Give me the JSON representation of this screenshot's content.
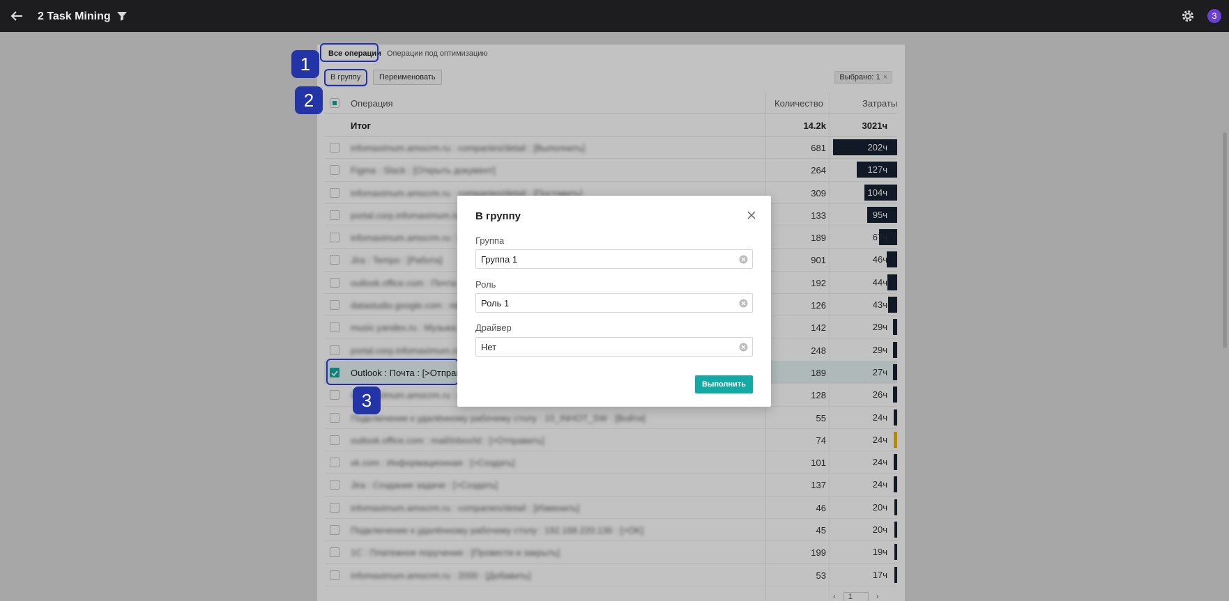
{
  "header": {
    "title": "2 Task Mining",
    "avatar_letter": "З"
  },
  "tabs": {
    "all": "Все операции",
    "optimization": "Операции под оптимизацию"
  },
  "toolbar": {
    "group_btn": "В группу",
    "rename_btn": "Переименовать",
    "selected": "Выбрано: 1",
    "clear": "×"
  },
  "table": {
    "col_operation": "Операция",
    "col_quantity": "Количество",
    "col_cost": "Затраты",
    "total": {
      "label": "Итог",
      "quantity": "14.2k",
      "cost": "3021ч"
    },
    "rows": [
      {
        "name": "infomaximum.amocrm.ru : companies/detail : [Выполнить]",
        "quantity": "681",
        "cost": "202ч",
        "fraction": 1.0
      },
      {
        "name": "Figma : Slack : [Открыть документ]",
        "quantity": "264",
        "cost": "127ч",
        "fraction": 0.63
      },
      {
        "name": "infomaximum.amocrm.ru : companies/detail : [Поставить]",
        "quantity": "309",
        "cost": "104ч",
        "fraction": 0.51
      },
      {
        "name": "portal.corp.infomaximum.ru : Задачи",
        "quantity": "133",
        "cost": "95ч",
        "fraction": 0.47
      },
      {
        "name": "infomaximum.amocrm.ru : leads",
        "quantity": "189",
        "cost": "67ч",
        "fraction": 0.28
      },
      {
        "name": "Jira : Tempo : [Работа]",
        "quantity": "901",
        "cost": "46ч",
        "fraction": 0.16
      },
      {
        "name": "outlook.office.com : Почта",
        "quantity": "192",
        "cost": "44ч",
        "fraction": 0.15
      },
      {
        "name": "datastudio.google.com : reporting",
        "quantity": "126",
        "cost": "43ч",
        "fraction": 0.14
      },
      {
        "name": "music.yandex.ru : Музыка",
        "quantity": "142",
        "cost": "29ч",
        "fraction": 0.07
      },
      {
        "name": "portal.corp.infomaximum.ru : Лента",
        "quantity": "248",
        "cost": "29ч",
        "fraction": 0.07
      },
      {
        "name": "Outlook : Почта : [>Отправить]",
        "quantity": "189",
        "cost": "27ч",
        "fraction": 0.06,
        "selected": true
      },
      {
        "name": "infomaximum.amocrm.ru : contacts",
        "quantity": "128",
        "cost": "26ч",
        "fraction": 0.06
      },
      {
        "name": "Подключение к удалённому рабочему столу : 10_INHOT_SW : [Войти]",
        "quantity": "55",
        "cost": "24ч",
        "fraction": 0.05
      },
      {
        "name": "outlook.office.com : mail/inbox/id : [>Отправить]",
        "quantity": "74",
        "cost": "24ч",
        "fraction": 0.05,
        "color": "#f0b400"
      },
      {
        "name": "vk.com : Информационная : [>Создать]",
        "quantity": "101",
        "cost": "24ч",
        "fraction": 0.05
      },
      {
        "name": "Jira : Создание задачи : [>Создать]",
        "quantity": "137",
        "cost": "24ч",
        "fraction": 0.05
      },
      {
        "name": "infomaximum.amocrm.ru : companies/detail : [Изменить]",
        "quantity": "46",
        "cost": "20ч",
        "fraction": 0.03
      },
      {
        "name": "Подключение к удалённому рабочему столу : 192.168.220.136 : [>OK]",
        "quantity": "45",
        "cost": "20ч",
        "fraction": 0.03
      },
      {
        "name": "1С : Платежное поручение : [Провести и закрыть]",
        "quantity": "199",
        "cost": "19ч",
        "fraction": 0.02
      },
      {
        "name": "infomaximum.amocrm.ru : 2000 : [Добавить]",
        "quantity": "53",
        "cost": "17ч",
        "fraction": 0.01
      }
    ]
  },
  "pager": {
    "page": "1",
    "prev": "‹",
    "next": "›"
  },
  "annotations": {
    "b1": "1",
    "b2": "2",
    "b3": "3"
  },
  "modal": {
    "title": "В группу",
    "group_label": "Группа",
    "group_value": "Группа 1",
    "role_label": "Роль",
    "role_value": "Роль 1",
    "driver_label": "Драйвер",
    "driver_value": "Нет",
    "submit": "Выполнить"
  },
  "colors": {
    "accent": "#13aaa6",
    "bar": "#172033",
    "callout": "#2335a6",
    "topbar": "#1d1d1f"
  }
}
